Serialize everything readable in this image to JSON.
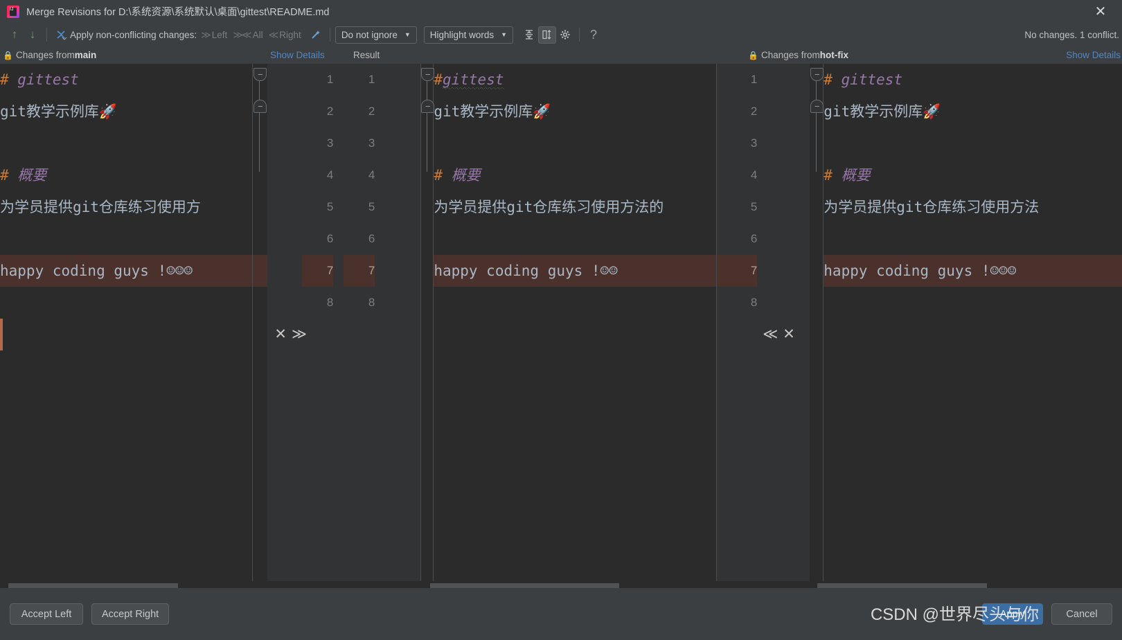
{
  "window": {
    "title": "Merge Revisions for D:\\系统资源\\系统默认\\桌面\\gittest\\README.md",
    "logo_icon": "intellij-idea-logo-icon",
    "close_icon": "✕"
  },
  "toolbar": {
    "prev_icon": "↑",
    "next_icon": "↓",
    "apply_all_icon": "apply-all-non-conflicting-icon",
    "apply_label": "Apply non-conflicting changes:",
    "apply_left": "Left",
    "apply_all": "All",
    "apply_right": "Right",
    "magic_icon": "magic-wand-icon",
    "chev_right": "≫",
    "chev_all": "≫≪",
    "chev_left": "≪",
    "ignore_policy": "Do not ignore",
    "highlight_policy": "Highlight words",
    "caret": "▼",
    "collapse_icon": "collapse-unchanged-fragments-icon",
    "whitespace_icon": "show-whitespace-icon",
    "settings_icon": "gear-icon",
    "help_icon": "?",
    "status": "No changes. 1 conflict."
  },
  "panes": {
    "left": {
      "lock_icon": "🔒",
      "header_prefix": "Changes from ",
      "branch": "main",
      "show_details": "Show Details"
    },
    "center": {
      "header": "Result"
    },
    "right": {
      "lock_icon": "🔒",
      "header_prefix": "Changes from ",
      "branch": "hot-fix",
      "show_details": "Show Details"
    }
  },
  "document": {
    "left_lines": [
      {
        "n": "1",
        "hash": "#",
        "text": " gittest",
        "kind": "heading"
      },
      {
        "n": "2",
        "hash": "",
        "text": "git教学示例库🚀",
        "kind": "plain"
      },
      {
        "n": "3",
        "hash": "",
        "text": "",
        "kind": "blank"
      },
      {
        "n": "4",
        "hash": "#",
        "text": " 概要",
        "kind": "heading"
      },
      {
        "n": "5",
        "hash": "",
        "text": "为学员提供git仓库练习使用方",
        "kind": "plain"
      },
      {
        "n": "6",
        "hash": "",
        "text": "",
        "kind": "blank"
      },
      {
        "n": "7",
        "hash": "",
        "text": "happy coding guys !☺☺☺",
        "kind": "conflict"
      },
      {
        "n": "8",
        "hash": "",
        "text": "",
        "kind": "blank"
      }
    ],
    "center_lines": [
      {
        "n": "1",
        "hash": "#",
        "text": " gittest",
        "kind": "heading-squiggle"
      },
      {
        "n": "2",
        "hash": "",
        "text": "git教学示例库🚀",
        "kind": "plain"
      },
      {
        "n": "3",
        "hash": "",
        "text": "",
        "kind": "blank"
      },
      {
        "n": "4",
        "hash": "#",
        "text": " 概要",
        "kind": "heading"
      },
      {
        "n": "5",
        "hash": "",
        "text": "为学员提供git仓库练习使用方法的",
        "kind": "plain"
      },
      {
        "n": "6",
        "hash": "",
        "text": "",
        "kind": "blank"
      },
      {
        "n": "7",
        "hash": "",
        "text": "happy coding guys !☺☺",
        "kind": "conflict"
      },
      {
        "n": "8",
        "hash": "",
        "text": "",
        "kind": "blank"
      }
    ],
    "right_lines": [
      {
        "n": "1",
        "hash": "#",
        "text": " gittest",
        "kind": "heading"
      },
      {
        "n": "2",
        "hash": "",
        "text": "git教学示例库🚀",
        "kind": "plain"
      },
      {
        "n": "3",
        "hash": "",
        "text": "",
        "kind": "blank"
      },
      {
        "n": "4",
        "hash": "#",
        "text": " 概要",
        "kind": "heading"
      },
      {
        "n": "5",
        "hash": "",
        "text": "为学员提供git仓库练习使用方法",
        "kind": "plain"
      },
      {
        "n": "6",
        "hash": "",
        "text": "",
        "kind": "blank"
      },
      {
        "n": "7",
        "hash": "",
        "text": "happy coding guys !☺☺☺",
        "kind": "conflict"
      },
      {
        "n": "8",
        "hash": "",
        "text": "",
        "kind": "blank"
      }
    ]
  },
  "conflict_actions": {
    "left_ignore_icon": "✕",
    "left_accept_icon": "≫",
    "right_accept_icon": "≪",
    "right_ignore_icon": "✕",
    "line_number": "7"
  },
  "buttons": {
    "accept_left": "Accept Left",
    "accept_right": "Accept Right",
    "apply": "Apply",
    "cancel": "Cancel"
  },
  "watermark": "CSDN @世界尽头与你",
  "colors": {
    "accent_blue": "#4e87c7",
    "conflict_bg": "#4b312c",
    "conflict_edge": "#b5694a",
    "heading_hash": "#cc7832",
    "heading_text": "#9876aa",
    "editor_bg": "#2b2b2b",
    "chrome_bg": "#3c3f41",
    "primary_btn": "#3b6ea5"
  }
}
